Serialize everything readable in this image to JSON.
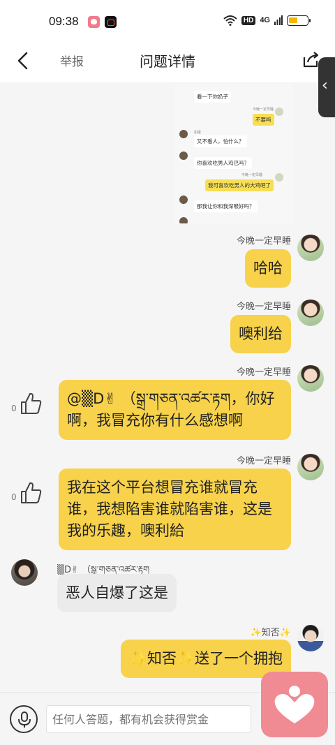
{
  "status": {
    "time": "09:38",
    "hd": "HD",
    "signal": "4G"
  },
  "nav": {
    "report": "举报",
    "title": "问题详情"
  },
  "embedded": {
    "line1": "看一下你奶子",
    "label_right_1": "今晚一定早睡",
    "bubble_right_1": "不要吗",
    "name_1": "如歌",
    "bubble_1": "又不看人，怕什么？",
    "bubble_2": "你喜欢吃男人鸡巴吗？",
    "label_right_2": "今晚一定早睡",
    "bubble_right_2": "我可喜欢吃男人的大鸡吧了",
    "bubble_3": "那我让你和我深喉好吗？"
  },
  "messages": [
    {
      "nick": "今晚一定早睡",
      "text": "哈哈"
    },
    {
      "nick": "今晚一定早睡",
      "text": "噢利给"
    },
    {
      "nick": "今晚一定早睡",
      "text": "@▒D✌ （སྒྲ་གཅན་འཚར་རྟག，你好啊，我冒充你有什么感想啊",
      "likes": "0"
    },
    {
      "nick": "今晚一定早睡",
      "text": "我在这个平台想冒充谁就冒充谁，我想陷害谁就陷害谁，这是我的乐趣，噢利給",
      "likes": "0"
    },
    {
      "nick": "▒D✌ （སྒྲ་གཅན་འཚར་རྟག",
      "text": "恶人自爆了这是"
    },
    {
      "nick": "✨知否✨",
      "text": "✨知否✨送了一个拥抱"
    }
  ],
  "input": {
    "placeholder": "任何人答题，都有机会获得赏金"
  },
  "colors": {
    "bubble_yellow": "#f7d24a",
    "bubble_gray": "#ebebeb",
    "fab_pink": "#f08b94"
  },
  "icons": [
    "back-icon",
    "share-icon",
    "collapse-icon",
    "like-icon",
    "mic-icon",
    "heart-icon"
  ]
}
